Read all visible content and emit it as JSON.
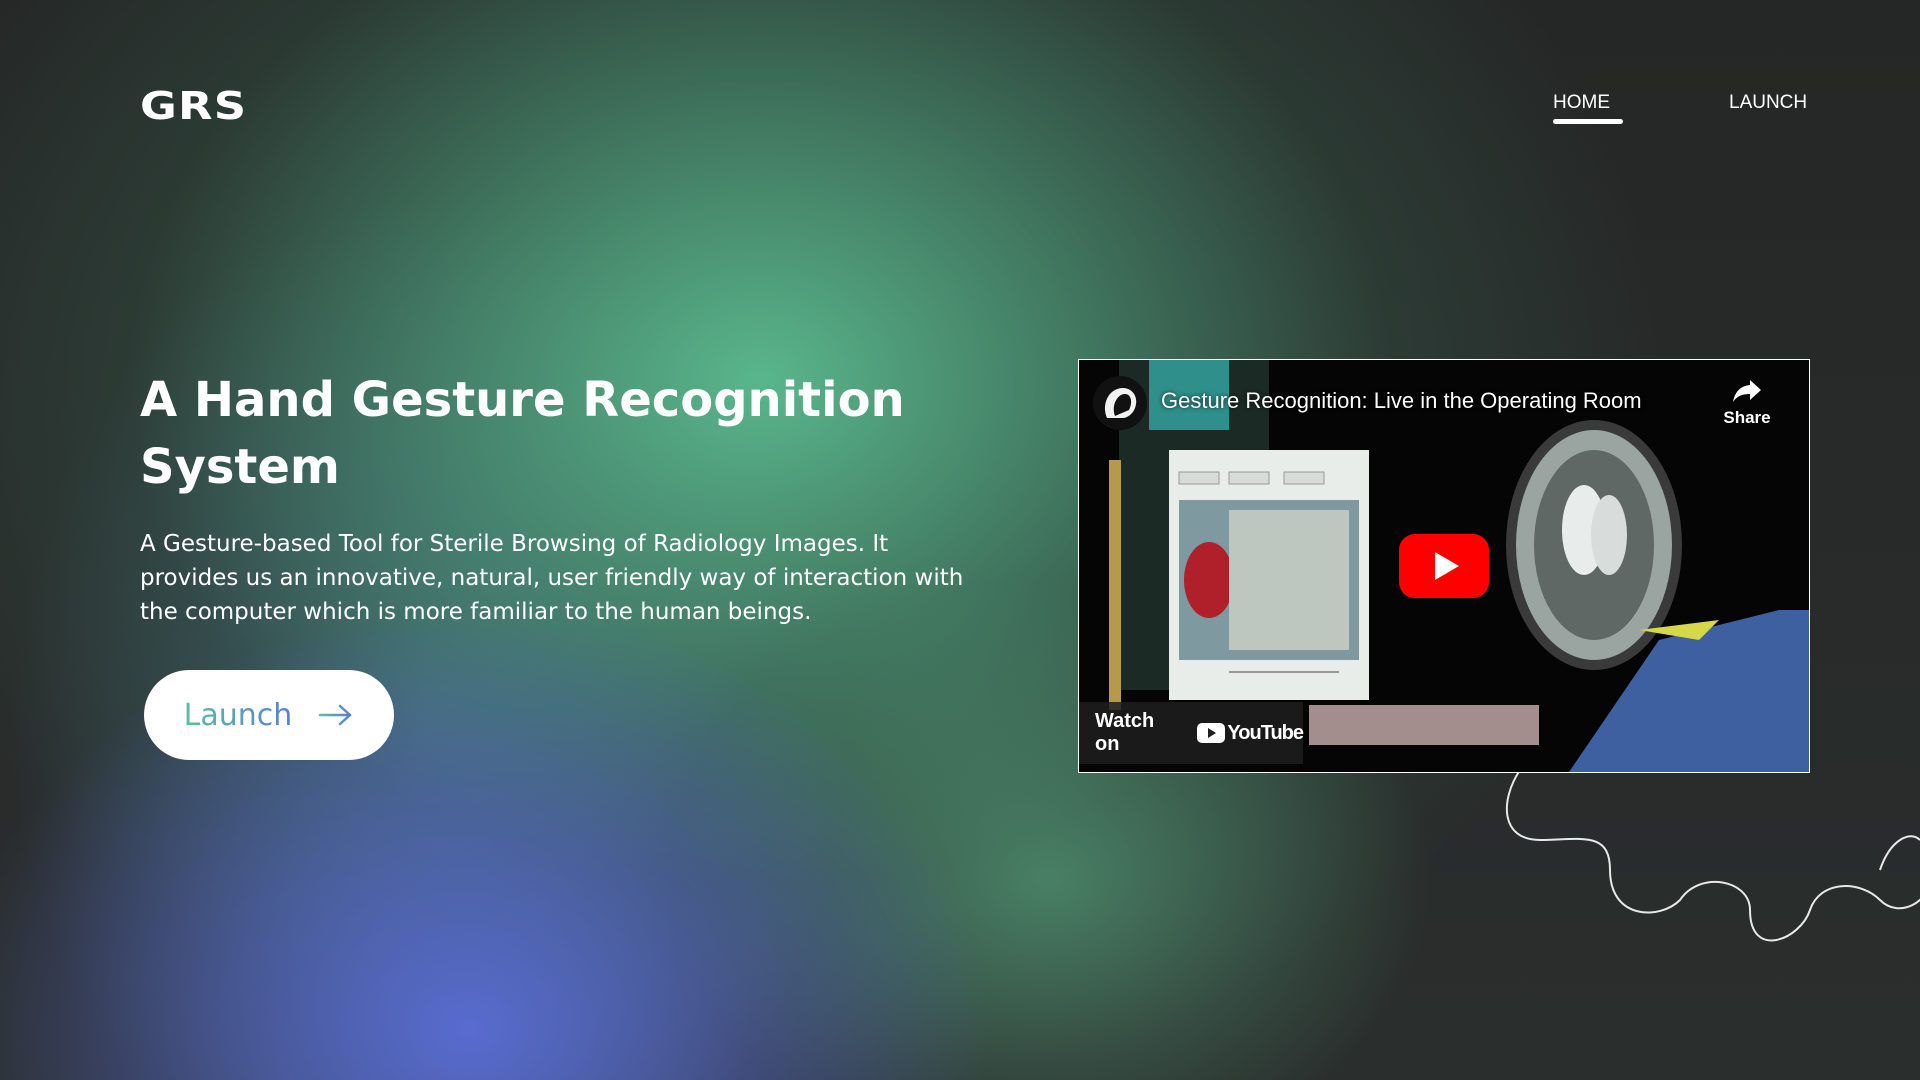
{
  "brand": {
    "logo_text": "GRS"
  },
  "nav": {
    "items": [
      {
        "label": "HOME",
        "active": true
      },
      {
        "label": "LAUNCH",
        "active": false
      }
    ]
  },
  "hero": {
    "title": "A Hand Gesture Recognition System",
    "description": "A Gesture-based Tool for Sterile Browsing of Radiology Images. It provides us an innovative, natural, user friendly way of interaction with the computer which is more familiar to the human beings.",
    "cta_label": "Launch",
    "cta_icon": "arrow-right-icon"
  },
  "video": {
    "title": "Gesture Recognition: Live in the Operating Room",
    "share_label": "Share",
    "share_icon": "share-icon",
    "play_icon": "youtube-play-icon",
    "watch_on_label": "Watch on",
    "platform_name": "YouTube"
  },
  "colors": {
    "background": "#262726",
    "accent_green": "#5bbfa0",
    "accent_blue": "#5a70d6",
    "youtube_red": "#ff0000",
    "button_bg": "#ffffff"
  }
}
